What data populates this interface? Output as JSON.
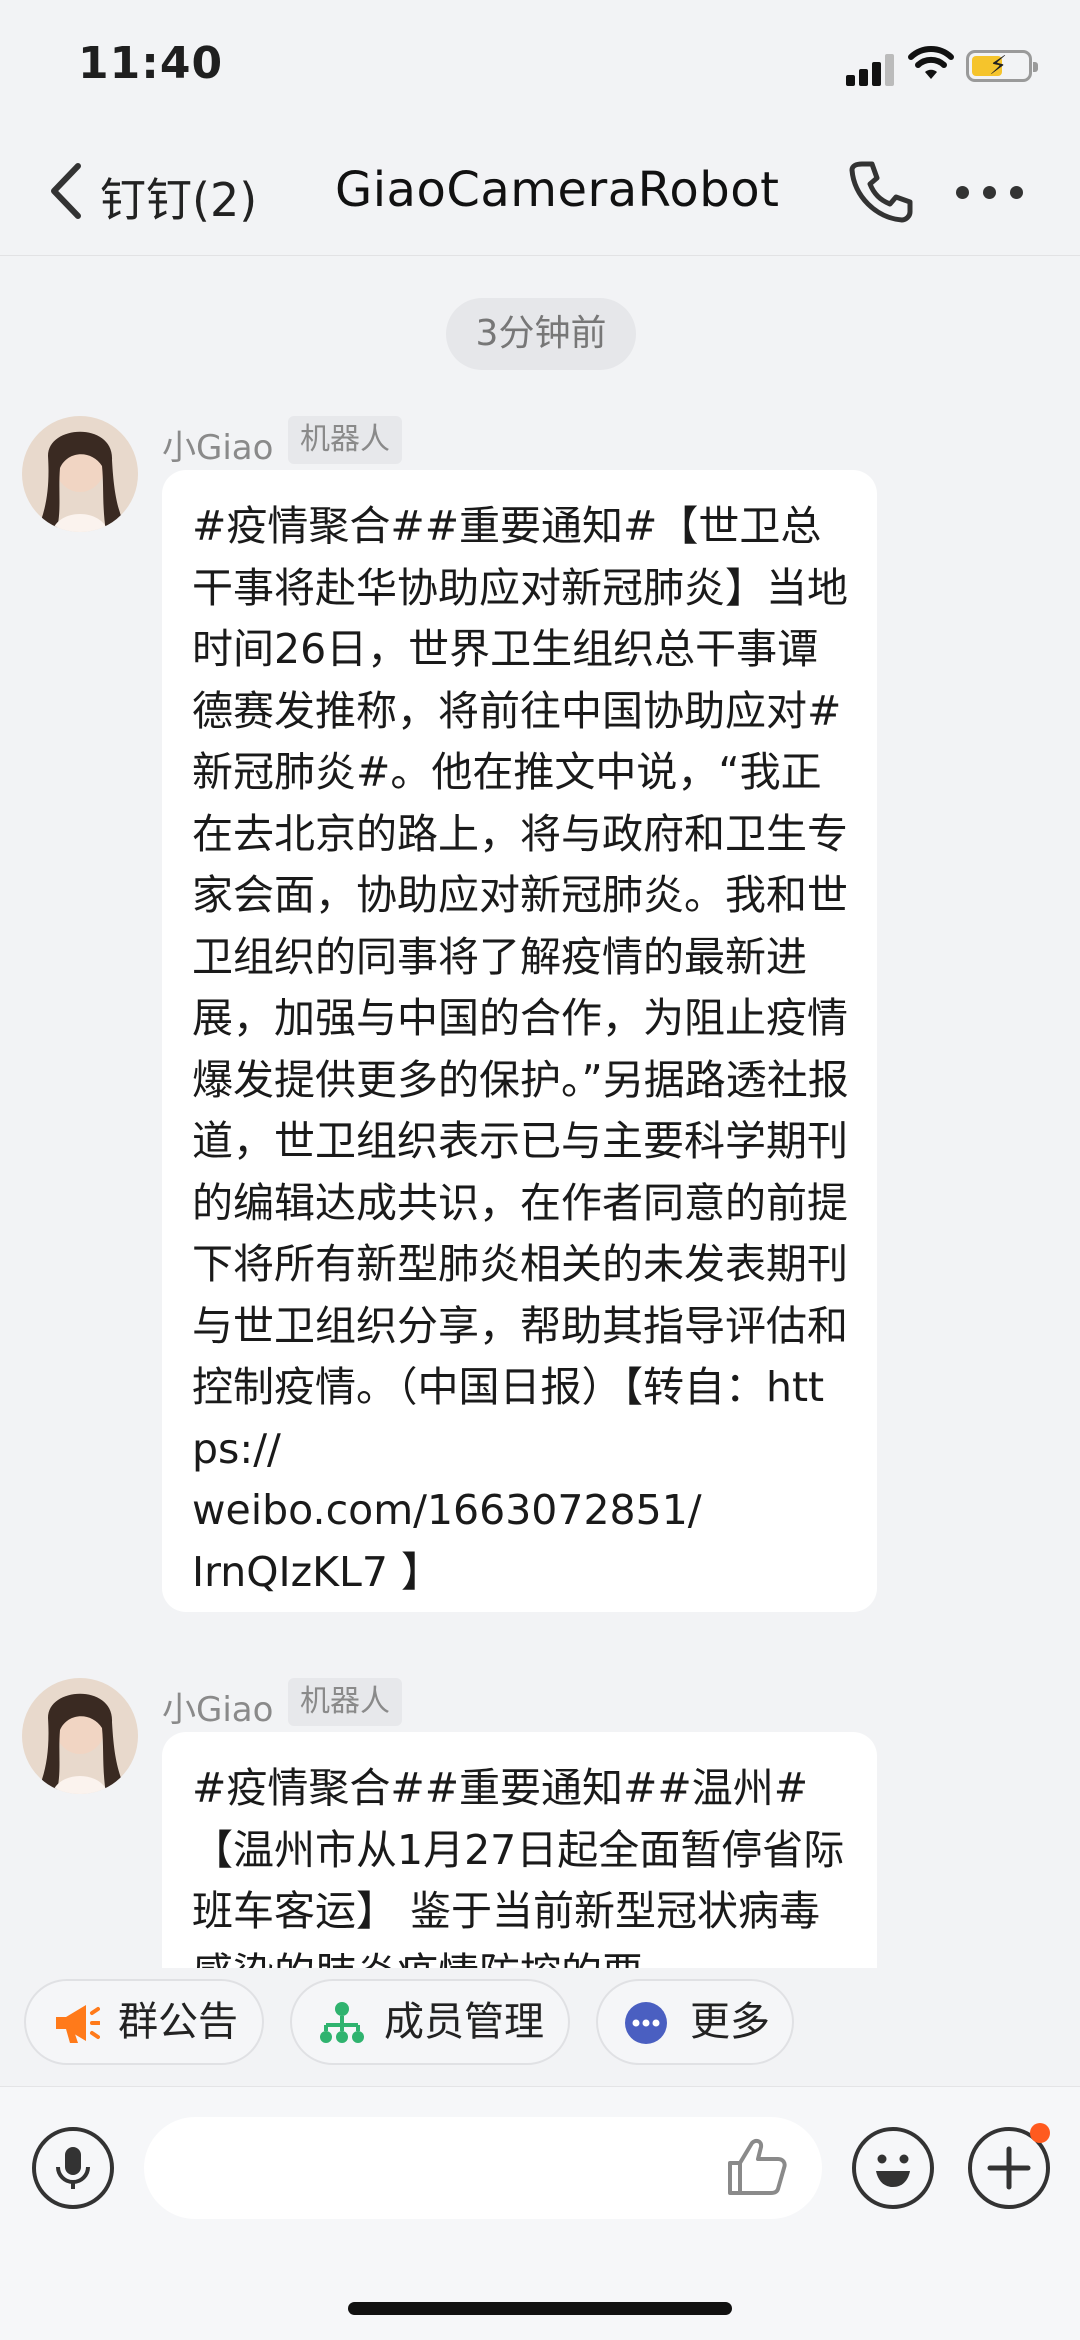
{
  "status_bar": {
    "time": "11:40"
  },
  "nav": {
    "back_label": "钉钉(2)",
    "title": "GiaoCameraRobot"
  },
  "timestamp": "3分钟前",
  "messages": [
    {
      "sender": "小Giao",
      "tag": "机器人",
      "text": "#疫情聚合##重要通知#【世卫总干事将赴华协助应对新冠肺炎】当地时间26日，世界卫生组织总干事谭德赛发推称，将前往中国协助应对#新冠肺炎#。他在推文中说，“我正在去北京的路上，将与政府和卫生专家会面，协助应对新冠肺炎。我和世卫组织的同事将了解疫情的最新进展，加强与中国的合作，为阻止疫情爆发提供更多的保护。”另据路透社报道，世卫组织表示已与主要科学期刊的编辑达成共识，在作者同意的前提下将所有新型肺炎相关的未发表期刊与世卫组织分享，帮助其指导评估和控制疫情。（中国日报）【转自：https://\nweibo.com/1663072851/\nIrnQIzKL7 】"
    },
    {
      "sender": "小Giao",
      "tag": "机器人",
      "text": "#疫情聚合##重要通知##温州#【温州市从1月27日起全面暂停省际班车客运】 鉴于当前新型冠状病毒感染的肺炎疫情防控的要"
    }
  ],
  "chips": [
    {
      "label": "群公告",
      "icon": "megaphone-icon"
    },
    {
      "label": "成员管理",
      "icon": "org-chart-icon"
    },
    {
      "label": "更多",
      "icon": "more-dots-icon"
    }
  ],
  "input": {
    "placeholder": ""
  },
  "colors": {
    "accent_orange": "#ff7a1a",
    "member_green": "#2fb36f",
    "more_blue": "#4a5fc1",
    "bubble_bg": "#ffffff",
    "page_bg": "#f2f3f5"
  }
}
